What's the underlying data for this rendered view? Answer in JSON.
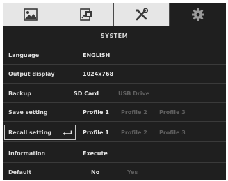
{
  "colors": {
    "background": "#1f1f1f",
    "tabbar": "#e6e6e6",
    "text": "#dcdcdc",
    "disabled": "#5f5f5f"
  },
  "tabs": [
    {
      "icon": "image-icon",
      "active": false
    },
    {
      "icon": "document-settings-icon",
      "active": false
    },
    {
      "icon": "tools-icon",
      "active": false
    },
    {
      "icon": "gear-icon",
      "active": true
    }
  ],
  "title": "SYSTEM",
  "rows": {
    "language": {
      "label": "Language",
      "value": "ENGLISH"
    },
    "output_display": {
      "label": "Output display",
      "value": "1024x768"
    },
    "backup": {
      "label": "Backup",
      "options": [
        "SD Card",
        "USB Drive"
      ],
      "selected": "SD Card"
    },
    "save_setting": {
      "label": "Save setting",
      "options": [
        "Profile 1",
        "Profile 2",
        "Profile 3"
      ],
      "selected": "Profile 1"
    },
    "recall_setting": {
      "label": "Recall setting",
      "options": [
        "Profile 1",
        "Profile 2",
        "Profile 3"
      ],
      "selected": "Profile 1",
      "icon": "enter-icon"
    },
    "information": {
      "label": "Information",
      "value": "Execute"
    },
    "default": {
      "label": "Default",
      "options": [
        "No",
        "Yes"
      ],
      "selected": "No"
    }
  }
}
